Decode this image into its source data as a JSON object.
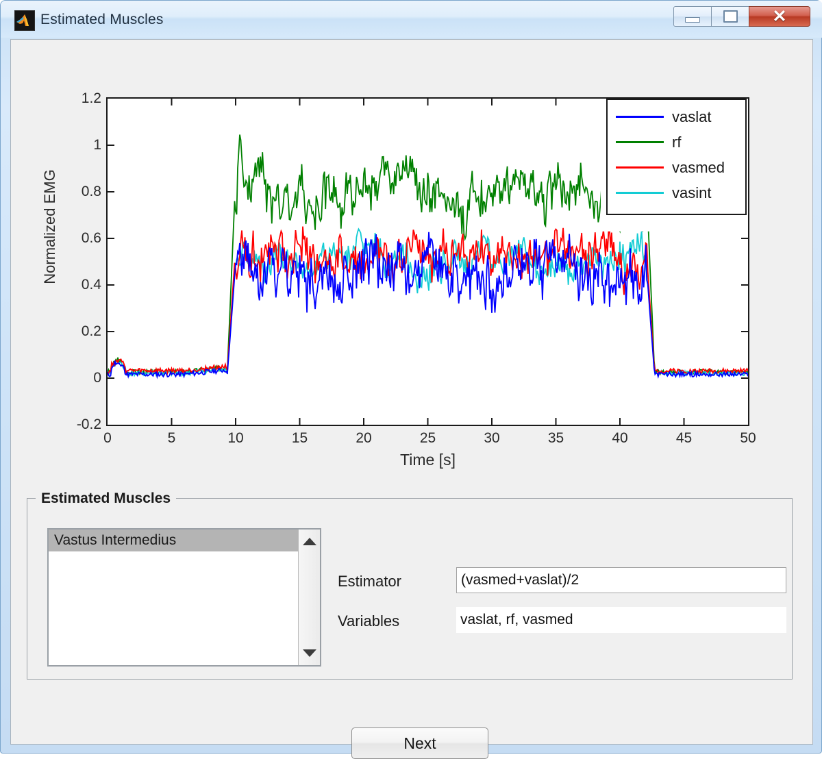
{
  "window": {
    "title": "Estimated Muscles",
    "icon": "matlab-logo-icon",
    "minimize_label": "",
    "maximize_label": "",
    "close_label": "✕"
  },
  "chart_data": {
    "type": "line",
    "title": "",
    "xlabel": "Time [s]",
    "ylabel": "Normalized EMG",
    "xlim": [
      0,
      50
    ],
    "ylim": [
      -0.2,
      1.2
    ],
    "xticks": [
      0,
      5,
      10,
      15,
      20,
      25,
      30,
      35,
      40,
      45,
      50
    ],
    "yticks": [
      -0.2,
      0,
      0.2,
      0.4,
      0.6,
      0.8,
      1,
      1.2
    ],
    "grid": false,
    "legend_position": "top-right",
    "series": [
      {
        "name": "vaslat",
        "color": "#0000ff",
        "baseline": 0.015,
        "active_mean": 0.46,
        "active_noise": 0.11,
        "onset": 9.6,
        "offset": 42.1,
        "x_end": 50,
        "seed": 11
      },
      {
        "name": "rf",
        "color": "#008000",
        "baseline": 0.025,
        "active_mean": 0.8,
        "active_noise": 0.1,
        "onset": 9.6,
        "offset": 42.1,
        "x_end": 50,
        "seed": 3,
        "spike_time": 10.35,
        "spike_value": 1.07
      },
      {
        "name": "vasmed",
        "color": "#ff0000",
        "baseline": 0.03,
        "active_mean": 0.52,
        "active_noise": 0.09,
        "onset": 9.6,
        "offset": 42.1,
        "x_end": 50,
        "seed": 27
      },
      {
        "name": "vasint",
        "color": "#13ccd4",
        "baseline": 0.02,
        "active_mean": 0.5,
        "active_noise": 0.07,
        "onset": 9.6,
        "offset": 42.1,
        "x_end": 50,
        "seed": 41
      }
    ]
  },
  "legend": {
    "entries": [
      {
        "label": "vaslat",
        "color": "#0000ff"
      },
      {
        "label": "rf",
        "color": "#008000"
      },
      {
        "label": "vasmed",
        "color": "#ff0000"
      },
      {
        "label": "vasint",
        "color": "#13ccd4"
      }
    ]
  },
  "panel": {
    "title": "Estimated Muscles",
    "listbox": {
      "items": [
        {
          "label": "Vastus Intermedius",
          "selected": true
        }
      ]
    },
    "fields": {
      "estimator_label": "Estimator",
      "estimator_value": "(vasmed+vaslat)/2",
      "variables_label": "Variables",
      "variables_value": "vaslat, rf, vasmed"
    }
  },
  "footer": {
    "next_label": "Next"
  }
}
